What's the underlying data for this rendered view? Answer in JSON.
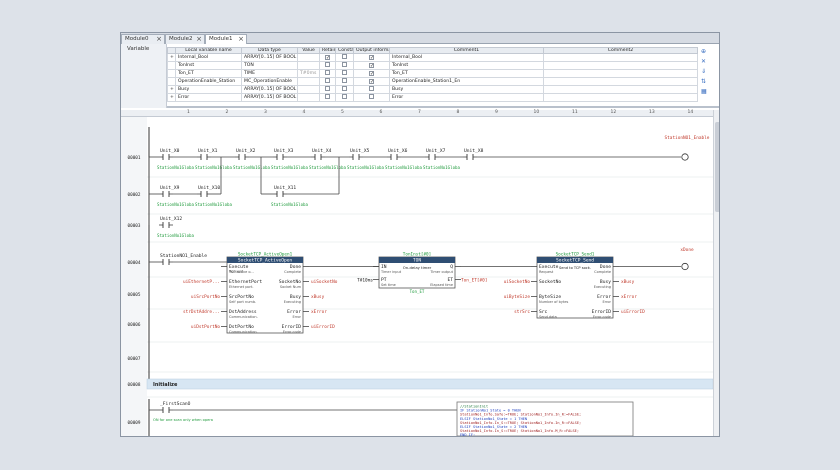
{
  "tabs": [
    {
      "label": "Module0",
      "active": false
    },
    {
      "label": "Module2",
      "active": false
    },
    {
      "label": "Module1",
      "active": true
    }
  ],
  "variable_pane": {
    "title": "Variable",
    "columns": [
      "Local variable name",
      "Data type",
      "Value",
      "Retain",
      "Constant",
      "Output information",
      "Comment1",
      "Comment2"
    ],
    "rows": [
      {
        "name": "Internal_Bool",
        "type": "ARRAY[0..15] OF BOOL",
        "value": "",
        "retain": true,
        "constant": false,
        "output": true,
        "comment1": "Internal_Bool",
        "comment2": ""
      },
      {
        "name": "TonInst",
        "type": "TON",
        "value": "",
        "retain": false,
        "constant": false,
        "output": true,
        "comment1": "TonInst",
        "comment2": ""
      },
      {
        "name": "Ton_ET",
        "type": "TIME",
        "value": "T#0ms",
        "retain": false,
        "constant": false,
        "output": true,
        "comment1": "Ton_ET",
        "comment2": ""
      },
      {
        "name": "OperationEnable_Station",
        "type": "MC_OperationEnable",
        "value": "",
        "retain": false,
        "constant": false,
        "output": true,
        "comment1": "OperationEnable_Station1_En",
        "comment2": ""
      },
      {
        "name": "Busy",
        "type": "ARRAY[0..15] OF BOOL",
        "value": "",
        "retain": false,
        "constant": false,
        "output": false,
        "comment1": "Busy",
        "comment2": ""
      },
      {
        "name": "Error",
        "type": "ARRAY[0..15] OF BOOL",
        "value": "",
        "retain": false,
        "constant": false,
        "output": false,
        "comment1": "Error",
        "comment2": ""
      }
    ]
  },
  "ruler": [
    "1",
    "2",
    "3",
    "4",
    "5",
    "6",
    "7",
    "8",
    "9",
    "10",
    "11",
    "12",
    "13",
    "14"
  ],
  "rungs": {
    "numbers": [
      "00001",
      "00002",
      "00003",
      "00004",
      "00005",
      "00006",
      "00007",
      "00008",
      "00009"
    ],
    "contacts_row1": [
      "Unit_X0",
      "Unit_X1",
      "Unit_X2",
      "Unit_X3",
      "Unit_X4",
      "Unit_X5",
      "Unit_X6",
      "Unit_X7",
      "Unit_X8"
    ],
    "contacts_row2": [
      "Unit_X9",
      "Unit_X10",
      "Unit_X11"
    ],
    "contact_row3": "Unit_X12",
    "contact_sub": "StationNo1Globa",
    "coil_row1": "StationNO1_Enable",
    "rung4_contact": "StationNO1_Enable",
    "rung4_coil": "xDone",
    "section_title": "Initialize",
    "first_scan": "_FirstScanO",
    "first_scan_comment": "ON for one scan only when opera"
  },
  "fb_open": {
    "instance": "SocketTCP_ActiveOpen1",
    "type": "SocketTCP_ActiveOpen",
    "inputs": [
      "Execute",
      "EthernetPort",
      "SrcPortNo",
      "DstAddress",
      "DstPortNo"
    ],
    "input_comments": [
      "TCP active o...",
      "Ethernet port.",
      "Self port numb.",
      "Communication.",
      "Communication."
    ],
    "outputs": [
      "Done",
      "SocketNo",
      "Busy",
      "Error",
      "ErrorID"
    ],
    "output_comments": [
      "Complete",
      "Socket Num",
      "Executing",
      "Error",
      "Error code"
    ],
    "in_vars": [
      "uiEthernetP...",
      "uiSrcPortNo",
      "strDstAddre...",
      "uiDstPortNo"
    ],
    "out_vars": [
      "uiSocketNo",
      "xBusy",
      "xError",
      "uiErrorID"
    ],
    "request_label": "Request"
  },
  "fb_ton": {
    "instance": "TonInst[#0]",
    "type": "TON",
    "comment": "On-delay timer",
    "inputs": [
      "IN",
      "PT"
    ],
    "input_comments": [
      "Timer input",
      "Set time"
    ],
    "outputs": [
      "Q",
      "ET"
    ],
    "output_comments": [
      "Timer output",
      "Elapsed time"
    ],
    "pt_value": "T#10ms",
    "et_var": "Ton_ET[#0]",
    "et_var2": "Ton_ET"
  },
  "fb_send": {
    "instance": "SocketTCP_Send1",
    "type": "SocketTCP_Send",
    "comment": "Send to TCP sock.",
    "inputs": [
      "Execute",
      "SocketNo",
      "ByteSize",
      "Src"
    ],
    "input_comments": [
      "Request",
      "",
      "Number of bytes",
      "Send data"
    ],
    "outputs": [
      "Done",
      "Busy",
      "Error",
      "ErrorID"
    ],
    "output_comments": [
      "Complete",
      "Executing",
      "Error",
      "Error code"
    ],
    "in_vars": [
      "uiSocketNo",
      "uiByteSize",
      "strSrc"
    ],
    "out_vars": [
      "xBusy",
      "xError",
      "uiErrorID"
    ]
  },
  "st_block": {
    "lines": [
      "//StationInit",
      "IF StationNo1_State = 0 THEN",
      "    StationNo1_Info.Safe:=TRUE; StationNo1_Info.In_R:=FALSE;",
      "ELSIF StationNo1_State = 1 THEN",
      "    StationNo1_Info.In_S:=TRUE; StationNo1_Info.In_R:=FALSE;",
      "ELSIF StationNo1_State = 2 THEN",
      "    StationNo1_Info.In_S:=TRUE; StationNo1_Info.M_R:=FALSE;",
      "END_IF;"
    ]
  },
  "colors": {
    "var_green": "#1f9a3c",
    "var_red": "#c0392b",
    "fb_header": "#2f4e73",
    "section_bar": "#d7e6f3",
    "st_keyword": "#1e3fbf"
  }
}
